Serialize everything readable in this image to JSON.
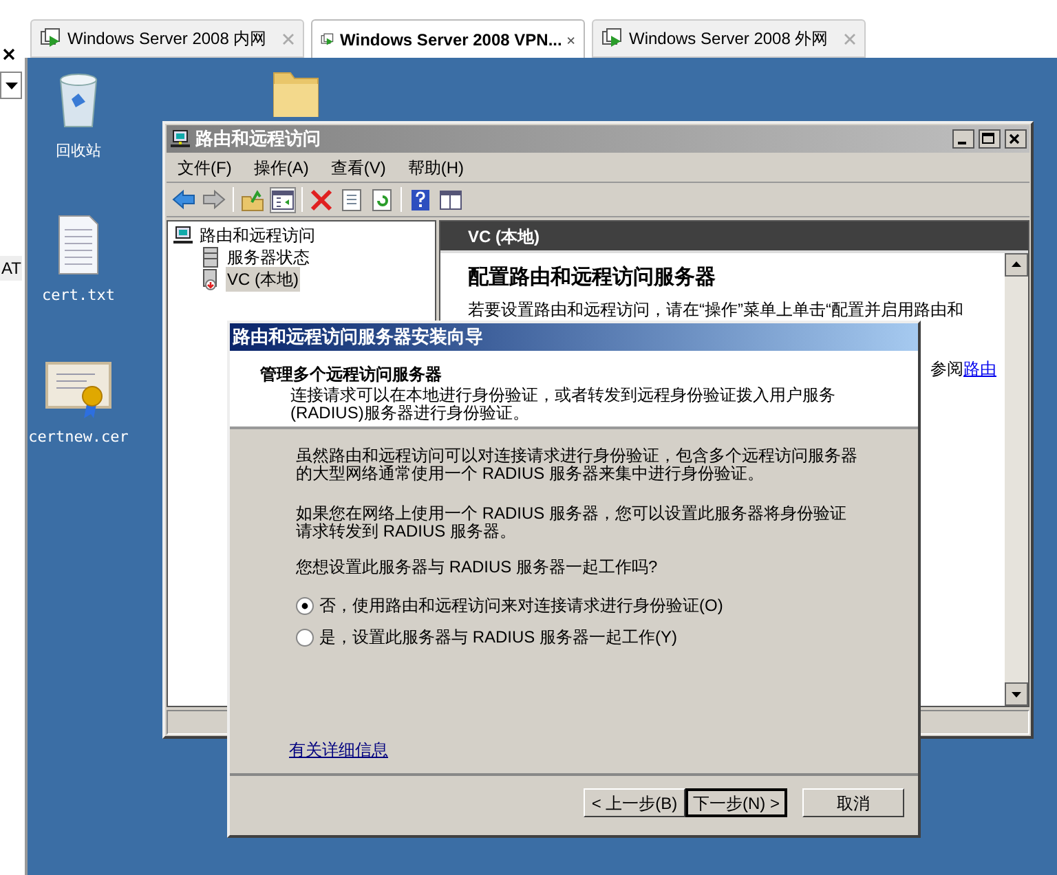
{
  "host_tabs": [
    {
      "label": "Windows Server 2008 内网",
      "selected": false
    },
    {
      "label": "Windows Server 2008 VPN...",
      "selected": true
    },
    {
      "label": "Windows Server 2008 外网",
      "selected": false
    }
  ],
  "host_sidebar": {
    "fragment": "AT"
  },
  "desktop_icons": [
    {
      "kind": "recycle_bin",
      "label": "回收站"
    },
    {
      "kind": "text_file",
      "label": "cert.txt"
    },
    {
      "kind": "certificate",
      "label": "certnew.cer"
    },
    {
      "kind": "folder"
    }
  ],
  "mmc": {
    "title": "路由和远程访问",
    "menu": [
      "文件(F)",
      "操作(A)",
      "查看(V)",
      "帮助(H)"
    ],
    "tree": [
      {
        "label": "路由和远程访问",
        "kind": "root",
        "selected": false,
        "children": [
          {
            "label": "服务器状态",
            "kind": "status",
            "selected": false
          },
          {
            "label": "VC (本地)",
            "kind": "server",
            "selected": true
          }
        ]
      }
    ],
    "pane_header": "VC (本地)",
    "heading": "配置路由和远程访问服务器",
    "text": "若要设置路由和远程访问，请在“操作”菜单上单击“配置并启用路由和",
    "text_2": "参阅",
    "link": "路由"
  },
  "wizard": {
    "title": "路由和远程访问服务器安装向导",
    "header_title": "管理多个远程访问服务器",
    "header_text": "连接请求可以在本地进行身份验证，或者转发到远程身份验证拨入用户服务(RADIUS)服务器进行身份验证。",
    "paragraphs": [
      "虽然路由和远程访问可以对连接请求进行身份验证，包含多个远程访问服务器的大型网络通常使用一个 RADIUS 服务器来集中进行身份验证。",
      "如果您在网络上使用一个 RADIUS 服务器，您可以设置此服务器将身份验证请求转发到 RADIUS 服务器。"
    ],
    "question": "您想设置此服务器与 RADIUS 服务器一起工作吗?",
    "options": [
      {
        "label": "否，使用路由和远程访问来对连接请求进行身份验证(O)",
        "selected": true
      },
      {
        "label": "是，设置此服务器与 RADIUS 服务器一起工作(Y)",
        "selected": false
      }
    ],
    "link": "有关详细信息",
    "buttons": [
      {
        "label": "< 上一步(B)",
        "default": false
      },
      {
        "label": "下一步(N) >",
        "default": true
      },
      {
        "label": "取消",
        "default": false
      }
    ]
  }
}
